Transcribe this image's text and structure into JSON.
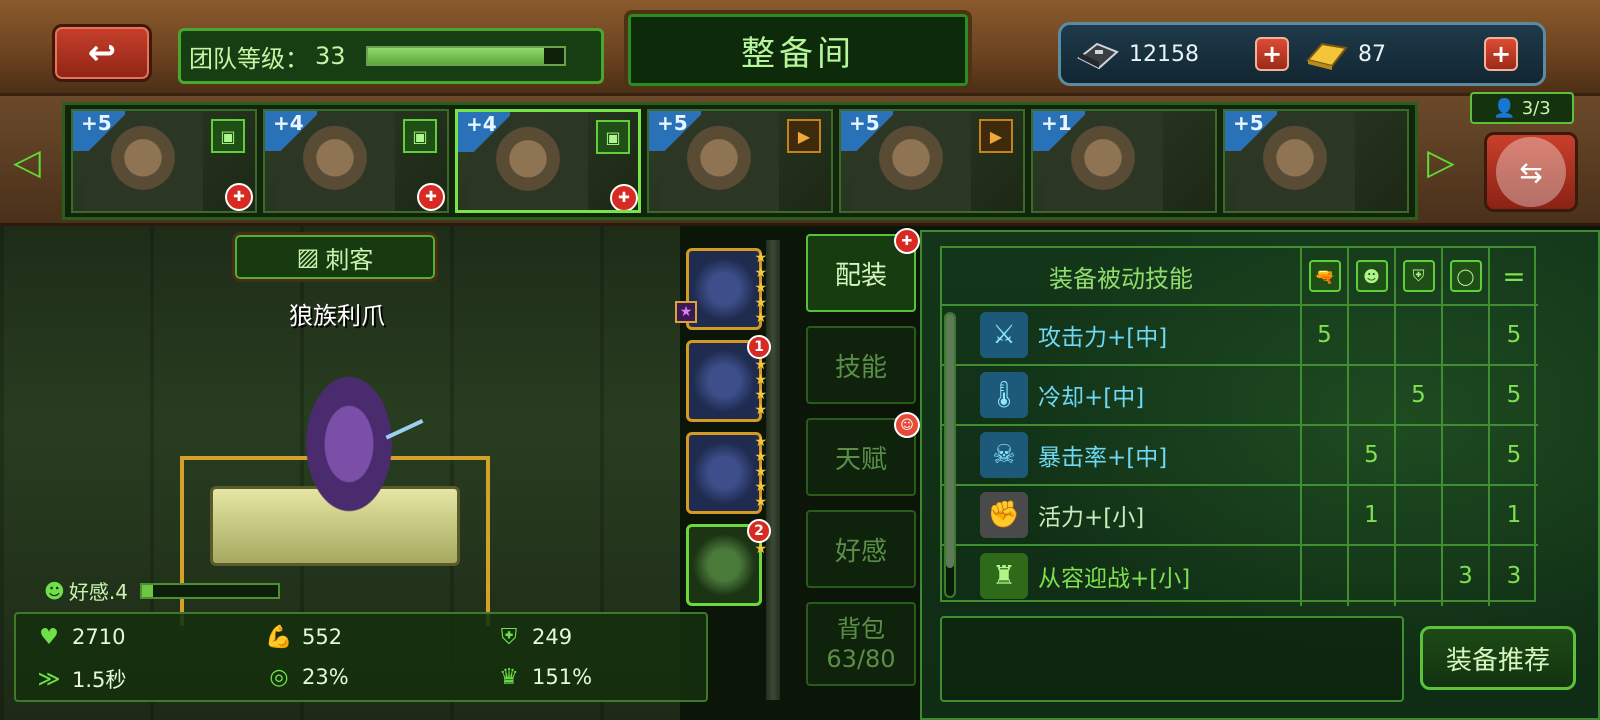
{
  "header": {
    "back_icon": "↩",
    "team_level_label": "团队等级：",
    "team_level_value": "33",
    "team_level_progress": 0.9,
    "title": "整备间",
    "currency": [
      {
        "icon": "metal-ingot-icon",
        "value": "12158",
        "add": "+"
      },
      {
        "icon": "gold-bar-icon",
        "value": "87",
        "add": "+"
      }
    ]
  },
  "roster": {
    "left_arrow": "◁",
    "right_arrow": "▷",
    "team_count": "3/3",
    "heroes": [
      {
        "rank": "+5",
        "role": "in-team",
        "badge": "✚"
      },
      {
        "rank": "+4",
        "role": "in-team",
        "badge": "✚"
      },
      {
        "rank": "+4",
        "role": "in-team",
        "badge": "✚",
        "selected": true
      },
      {
        "rank": "+5",
        "role": "swap"
      },
      {
        "rank": "+5",
        "role": "swap"
      },
      {
        "rank": "+1",
        "role": ""
      },
      {
        "rank": "+5",
        "role": ""
      }
    ]
  },
  "character": {
    "class_label": "刺客",
    "weapon_name": "狼族利爪",
    "affinity_label": "好感.4",
    "affinity_progress": 0.08,
    "stats": {
      "hp": "2710",
      "attack": "552",
      "armor": "249",
      "cooldown": "1.5秒",
      "crit": "23%",
      "crit_damage": "151%"
    }
  },
  "gear_slots": [
    {
      "stars": 5,
      "gem": "★"
    },
    {
      "stars": 5,
      "badge": "1"
    },
    {
      "stars": 5
    },
    {
      "stars": 2,
      "badge": "2"
    }
  ],
  "tabs": {
    "equip": "配装",
    "skills": "技能",
    "talent": "天赋",
    "affinity": "好感",
    "bag": "背包",
    "bag_count": "63/80"
  },
  "passive": {
    "title": "装备被动技能",
    "total_symbol": "=",
    "rows": [
      {
        "name": "攻击力+[中]",
        "icon": "attack-icon",
        "c1": "5",
        "c2": "",
        "c3": "",
        "c4": "",
        "total": "5",
        "color": "cyan"
      },
      {
        "name": "冷却+[中]",
        "icon": "thermometer-icon",
        "c1": "",
        "c2": "",
        "c3": "5",
        "c4": "",
        "total": "5",
        "color": "cyan"
      },
      {
        "name": "暴击率+[中]",
        "icon": "crit-skull-icon",
        "c1": "",
        "c2": "5",
        "c3": "",
        "c4": "",
        "total": "5",
        "color": "cyan"
      },
      {
        "name": "活力+[小]",
        "icon": "vitality-arm-icon",
        "c1": "",
        "c2": "1",
        "c3": "",
        "c4": "",
        "total": "1",
        "color": "white"
      },
      {
        "name": "从容迎战+[小]",
        "icon": "calm-battle-icon",
        "c1": "",
        "c2": "",
        "c3": "",
        "c4": "3",
        "total": "3",
        "color": "green"
      }
    ],
    "recommend_button": "装备推荐"
  }
}
